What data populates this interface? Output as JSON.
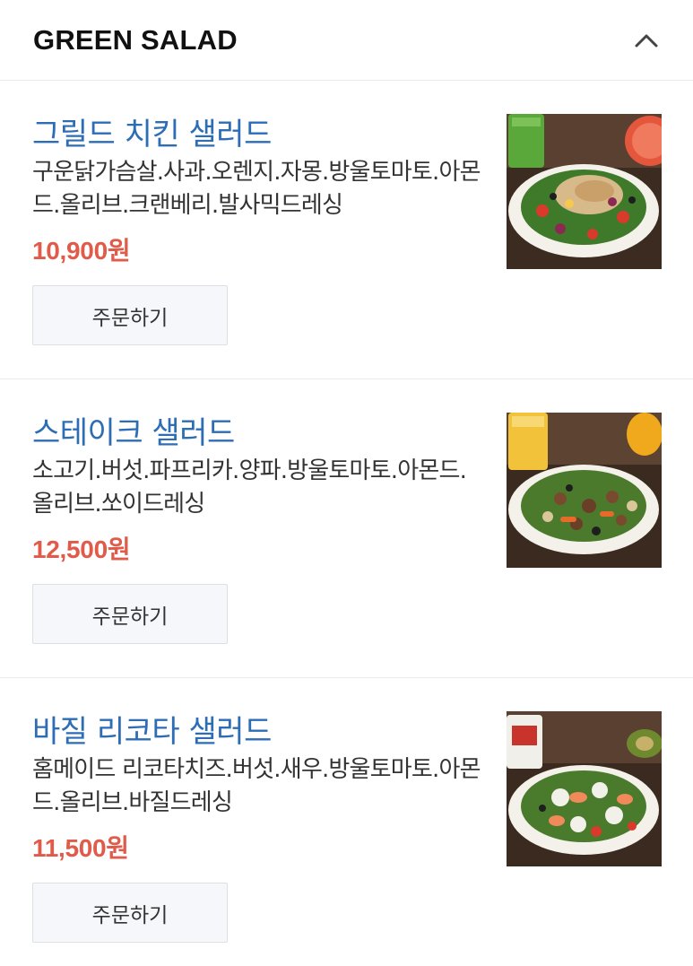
{
  "section": {
    "title": "GREEN SALAD",
    "collapse_icon": "chevron-up-icon"
  },
  "items": [
    {
      "name": "그릴드 치킨 샐러드",
      "description": "구운닭가슴살.사과.오렌지.자몽.방울토마토.아몬드.올리브.크랜베리.발사믹드레싱",
      "price": "10,900원",
      "order_label": "주문하기",
      "photo": "grilled-chicken-salad-photo",
      "colors": {
        "drink": "#5aa83a",
        "accent": "#e4573c",
        "topping": "#d8b98a"
      }
    },
    {
      "name": "스테이크 샐러드",
      "description": "소고기.버섯.파프리카.양파.방울토마토.아몬드.올리브.쏘이드레싱",
      "price": "12,500원",
      "order_label": "주문하기",
      "photo": "steak-salad-photo",
      "colors": {
        "drink": "#f2c23a",
        "accent": "#f0a81c",
        "topping": "#7a4a2e"
      }
    },
    {
      "name": "바질 리코타 샐러드",
      "description": "홈메이드 리코타치즈.버섯.새우.방울토마토.아몬드.올리브.바질드레싱",
      "price": "11,500원",
      "order_label": "주문하기",
      "photo": "basil-ricotta-salad-photo",
      "colors": {
        "drink": "#c8342c",
        "accent": "#6f8a2e",
        "topping": "#f1f1ea"
      }
    }
  ],
  "theme": {
    "name_color": "#2c6db5",
    "price_color": "#e15b4a",
    "divider_color": "#ebebeb",
    "button_bg": "#f5f7fa"
  }
}
